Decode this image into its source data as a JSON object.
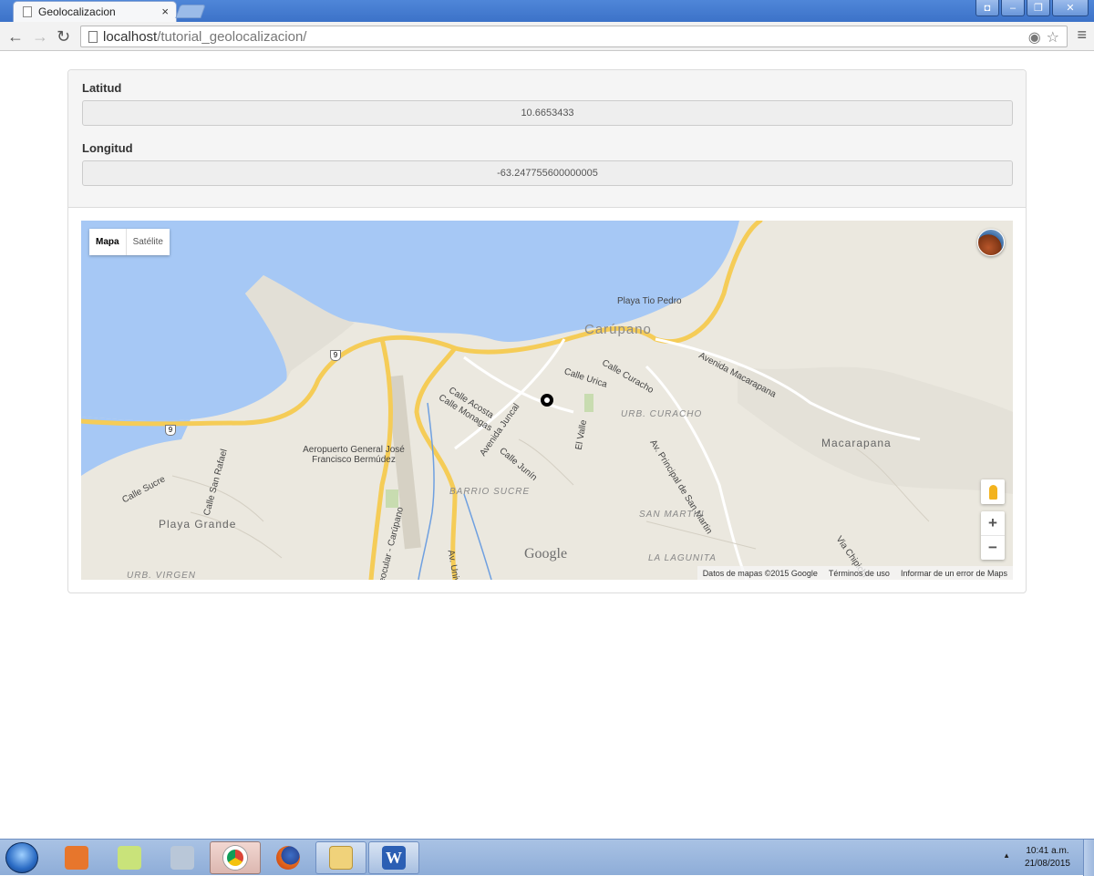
{
  "browser": {
    "tab_title": "Geolocalizacion",
    "tab_close": "×",
    "url_host": "localhost",
    "url_path": "/tutorial_geolocalizacion/"
  },
  "form": {
    "lat_label": "Latitud",
    "lat_value": "10.6653433",
    "lng_label": "Longitud",
    "lng_value": "-63.247755600000005"
  },
  "map": {
    "type_map": "Mapa",
    "type_satellite": "Satélite",
    "zoom_in": "+",
    "zoom_out": "−",
    "logo": "Google",
    "attribution_data": "Datos de mapas ©2015 Google",
    "attribution_terms": "Términos de uso",
    "attribution_report": "Informar de un error de Maps",
    "labels": {
      "playa_tio_pedro": "Playa Tio Pedro",
      "carupano": "Carúpano",
      "avenida_macarapana": "Avenida Macarapana",
      "calle_curacho": "Calle Curacho",
      "calle_urica": "Calle Urica",
      "urb_curacho": "URB. CURACHO",
      "macarapana": "Macarapana",
      "calle_acosta": "Calle Acosta",
      "calle_monagas": "Calle Monagas",
      "avenida_juncal": "Avenida Juncal",
      "el_valle": "El Valle",
      "calle_junin": "Calle Junín",
      "aeropuerto": "Aeropuerto General José Francisco Bermúdez",
      "barrio_sucre": "BARRIO SUCRE",
      "av_principal_san_martin": "Av. Principal de San Martin",
      "san_martin": "SAN MARTIN",
      "la_lagunita": "LA LAGUNITA",
      "via_chipichi": "Via Chipichi",
      "calle_sucre": "Calle Sucre",
      "calle_san_rafael": "Calle San Rafael",
      "playa_grande": "Playa Grande",
      "urb_virgen": "URB. VIRGEN",
      "ecocular_carupano": "eocular - Carúpano",
      "av_univ": "Av. Univ",
      "route_9": "9"
    }
  },
  "taskbar": {
    "time": "10:41 a.m.",
    "date": "21/08/2015"
  },
  "colors": {
    "water": "#a6c8f5",
    "land": "#ebe8df",
    "highway": "#f5cc57",
    "accent_panel": "#f5f5f5"
  }
}
